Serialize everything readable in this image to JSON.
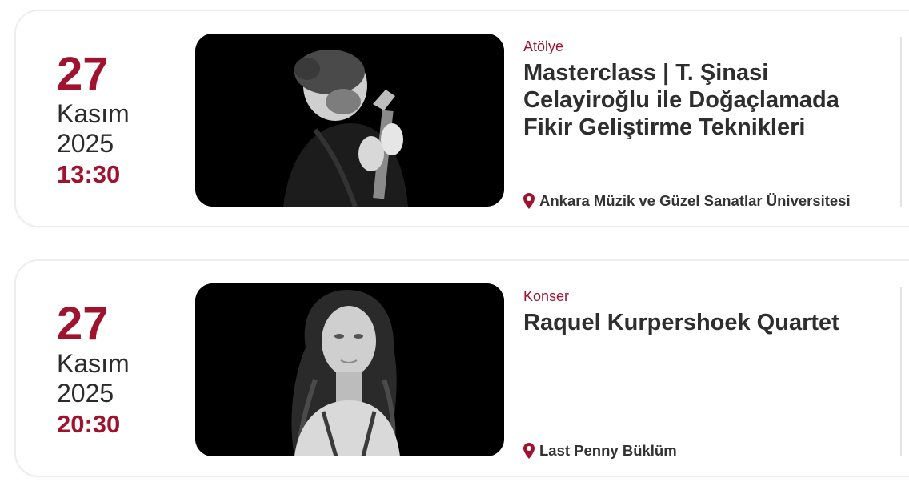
{
  "events": [
    {
      "day": "27",
      "month": "Kasım",
      "year": "2025",
      "time": "13:30",
      "category": "Atölye",
      "title": "Masterclass | T. Şinasi Celayiroğlu ile Doğaçlamada Fikir Geliştirme Teknikleri",
      "location": "Ankara Müzik ve Güzel Sanatlar Üniversitesi",
      "image_icon": "musician-with-oud-photo"
    },
    {
      "day": "27",
      "month": "Kasım",
      "year": "2025",
      "time": "20:30",
      "category": "Konser",
      "title": "Raquel Kurpershoek Quartet",
      "location": "Last Penny Büklüm",
      "image_icon": "woman-portrait-photo"
    }
  ],
  "colors": {
    "accent": "#a0132f",
    "title": "#2e2e2e",
    "text": "#2b2b2b",
    "card_border": "#eeeeee",
    "image_bg": "#000000"
  }
}
